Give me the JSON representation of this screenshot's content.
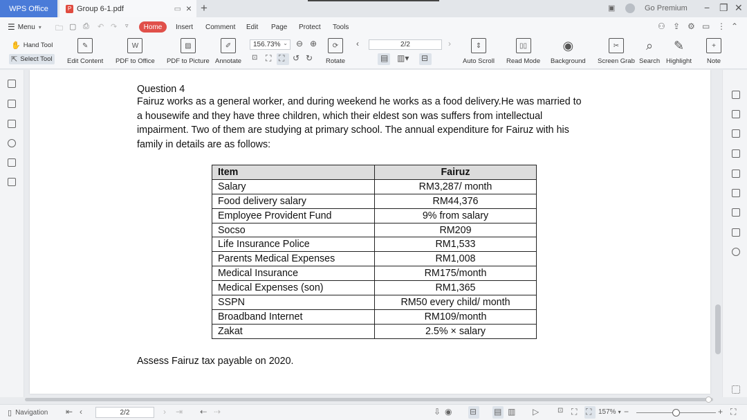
{
  "titlebar": {
    "app_tab": "WPS Office",
    "doc_tab": "Group 6-1.pdf",
    "premium": "Go Premium"
  },
  "menubar": {
    "menu_label": "Menu",
    "tabs": [
      "Home",
      "Insert",
      "Comment",
      "Edit",
      "Page",
      "Protect",
      "Tools"
    ]
  },
  "toolbar": {
    "hand_tool": "Hand Tool",
    "select_tool": "Select Tool",
    "edit_content": "Edit Content",
    "pdf_to_office": "PDF to Office",
    "pdf_to_picture": "PDF to Picture",
    "annotate": "Annotate",
    "zoom": "156.73%",
    "rotate": "Rotate",
    "page": "2/2",
    "auto_scroll": "Auto Scroll",
    "read_mode": "Read Mode",
    "background": "Background",
    "screen_grab": "Screen Grab",
    "search": "Search",
    "highlight": "Highlight",
    "note": "Note"
  },
  "document": {
    "question_title": "Question 4",
    "paragraph_lines": [
      "Fairuz works as a general worker, and during weekend he works as a food delivery.He was married to",
      "a housewife and they have three children, which their eldest son was suffers from intellectual",
      "impairment. Two of them are studying at primary school. The annual expenditure for Fairuz with his",
      "family in details are as follows:"
    ],
    "table": {
      "headers": [
        "Item",
        "Fairuz"
      ],
      "rows": [
        [
          "Salary",
          "RM3,287/ month"
        ],
        [
          "Food delivery salary",
          "RM44,376"
        ],
        [
          "Employee Provident Fund",
          "9% from salary"
        ],
        [
          "Socso",
          "RM209"
        ],
        [
          "Life Insurance Police",
          "RM1,533"
        ],
        [
          "Parents Medical Expenses",
          "RM1,008"
        ],
        [
          "Medical Insurance",
          "RM175/month"
        ],
        [
          "Medical Expenses (son)",
          "RM1,365"
        ],
        [
          "SSPN",
          "RM50 every child/ month"
        ],
        [
          "Broadband Internet",
          "RM109/month"
        ],
        [
          "Zakat",
          "2.5% × salary"
        ]
      ]
    },
    "assess": "Assess Fairuz tax payable on 2020."
  },
  "statusbar": {
    "navigation": "Navigation",
    "page": "2/2",
    "zoom": "157%"
  },
  "colors": {
    "app_blue": "#4a7bd8",
    "home_red": "#e0504a"
  }
}
